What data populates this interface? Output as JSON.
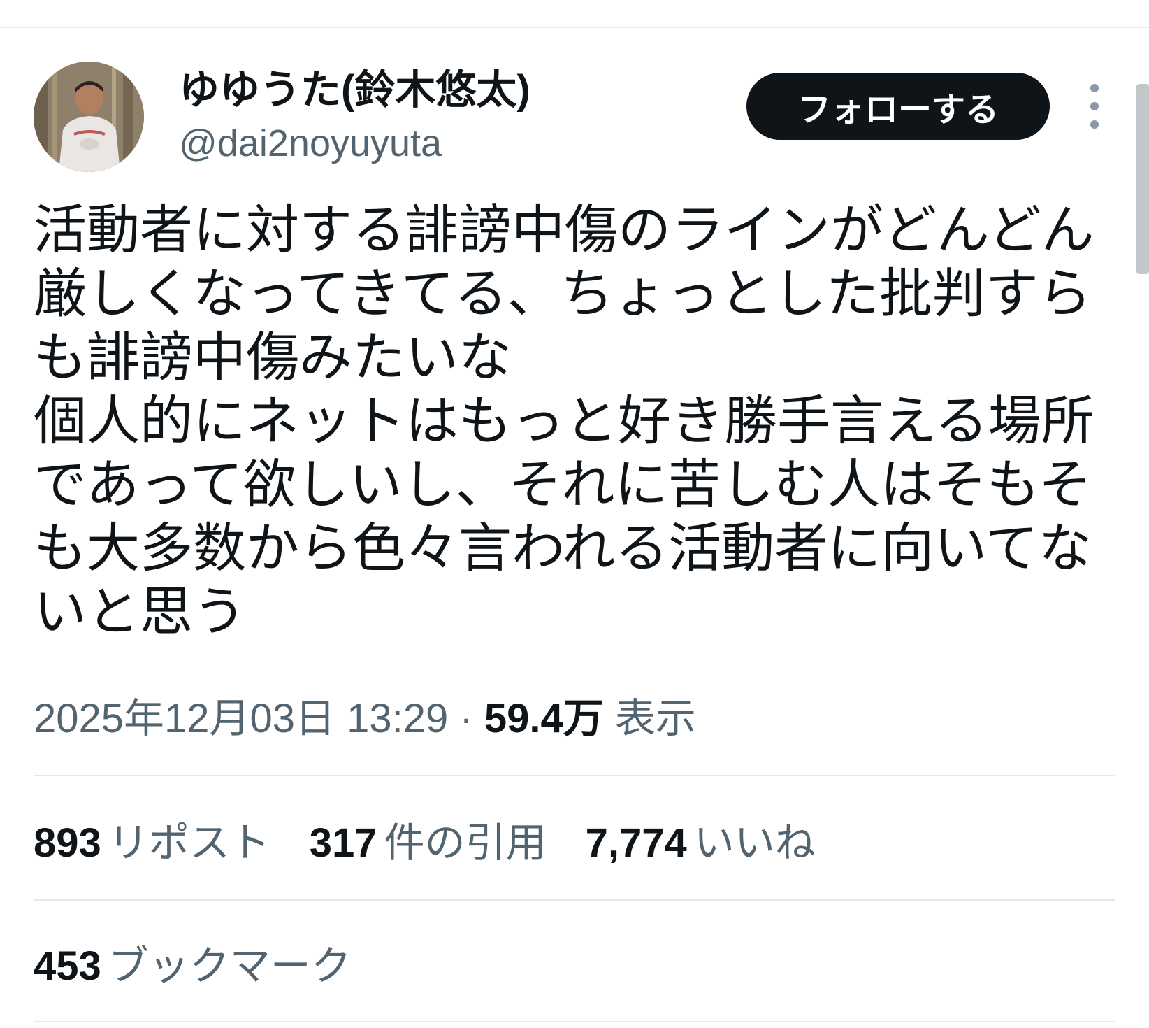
{
  "author": {
    "display_name": "ゆゆうた(鈴木悠太)",
    "handle": "@dai2noyuyuta",
    "avatar_icon": "user-avatar-photo"
  },
  "actions": {
    "follow_label": "フォローする",
    "more_icon": "vertical-ellipsis-icon"
  },
  "tweet": {
    "lines": [
      "活動者に対する誹謗中傷のラインがどんどん",
      "厳しくなってきてる、ちょっとした批判すら",
      "も誹謗中傷みたいな",
      "個人的にネットはもっと好き勝手言える場所",
      "であって欲しいし、それに苦しむ人はそもそ",
      "も大多数から色々言われる活動者に向いてな",
      "いと思う"
    ],
    "timestamp": "2025年12月03日 13:29",
    "separator": "·",
    "views_count": "59.4万",
    "views_label": "表示"
  },
  "stats": {
    "reposts": {
      "count": "893",
      "label": "リポスト"
    },
    "quotes": {
      "count": "317",
      "label": "件の引用"
    },
    "likes": {
      "count": "7,774",
      "label": "いいね"
    },
    "bookmarks": {
      "count": "453",
      "label": "ブックマーク"
    }
  },
  "colors": {
    "text_primary": "#0f1419",
    "text_secondary": "#536471",
    "divider": "#e6e9eb",
    "follow_button_bg": "#0f1419",
    "follow_button_text": "#ffffff"
  }
}
